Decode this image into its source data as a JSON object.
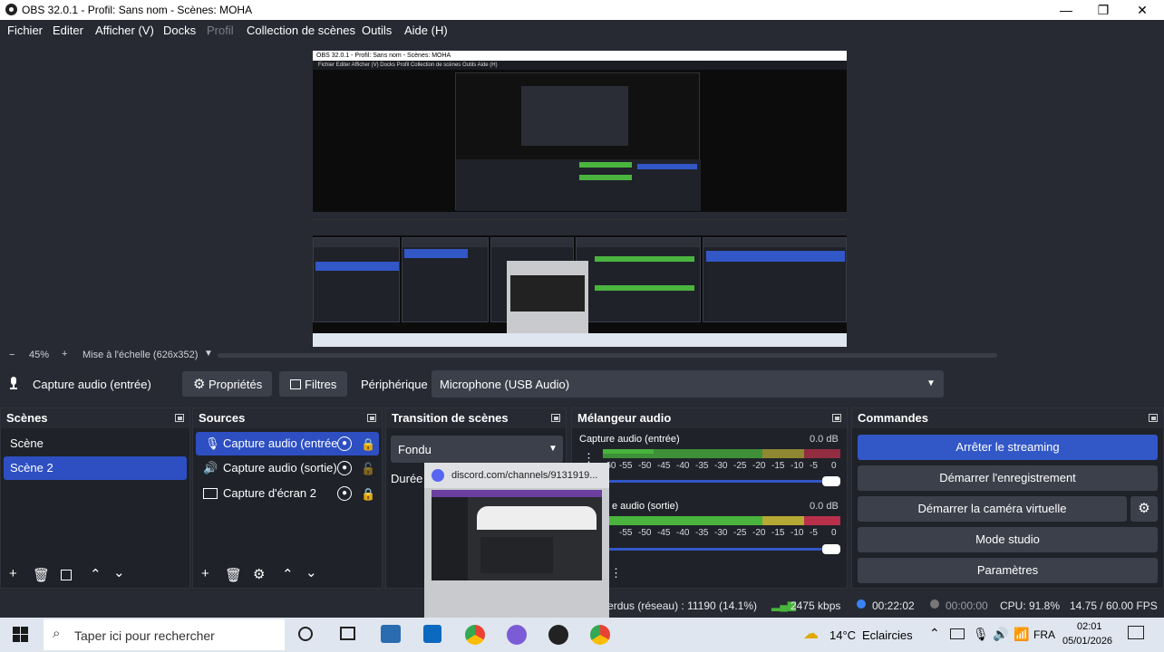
{
  "window": {
    "title": "OBS 32.0.1 - Profil: Sans nom - Scènes: MOHA",
    "minimize": "—",
    "maximize": "❐",
    "close": "✕"
  },
  "menu": [
    "Fichier",
    "Editer",
    "Afficher (V)",
    "Docks",
    "Profil",
    "Collection de scènes",
    "Outils",
    "Aide (H)"
  ],
  "zoom": {
    "minus": "−",
    "level": "45%",
    "plus": "+",
    "scale_label": "Mise à l'échelle (626x352)"
  },
  "source_bar": {
    "source_name": "Capture audio (entrée)",
    "properties_label": "Propriétés",
    "filters_label": "Filtres",
    "device_label": "Périphérique",
    "device_value": "Microphone (USB Audio)"
  },
  "scenes": {
    "title": "Scènes",
    "items": [
      "Scène",
      "Scène 2"
    ],
    "selected_index": 1
  },
  "sources": {
    "title": "Sources",
    "items": [
      "Capture audio (entrée",
      "Capture audio (sortie)",
      "Capture d'écran 2"
    ]
  },
  "transition": {
    "title": "Transition de scènes",
    "value": "Fondu",
    "duration_label": "Durée"
  },
  "mixer": {
    "title": "Mélangeur audio",
    "channels": [
      {
        "name": "Capture audio (entrée)",
        "db": "0.0 dB"
      },
      {
        "name": "e audio (sortie)",
        "db": "0.0 dB"
      }
    ],
    "ticks": [
      "-60",
      "-55",
      "-50",
      "-45",
      "-40",
      "-35",
      "-30",
      "-25",
      "-20",
      "-15",
      "-10",
      "-5",
      "0"
    ]
  },
  "commands": {
    "title": "Commandes",
    "buttons": [
      "Arrêter le streaming",
      "Démarrer l'enregistrement",
      "Démarrer la caméra virtuelle",
      "Mode studio",
      "Paramètres"
    ]
  },
  "status": {
    "dropped": "Paquets perdus (réseau) : 11190 (14.1%)",
    "bitrate": "2475 kbps",
    "stream_time": "00:22:02",
    "rec_time": "00:00:00",
    "cpu": "CPU: 91.8%",
    "fps": "14.75 / 60.00 FPS"
  },
  "discord_preview": {
    "url": "discord.com/channels/9131919..."
  },
  "taskbar": {
    "search_placeholder": "Taper ici pour rechercher",
    "weather_temp": "14°C",
    "weather_text": "Eclaircies",
    "language": "FRA",
    "time": "02:01",
    "date": "05/01/2026"
  },
  "nested_preview": {
    "title": "OBS 32.0.1 - Profil: Sans nom - Scènes: MOHA",
    "menu": "Fichier  Editer  Afficher (V)  Docks  Profil  Collection de scènes  Outils  Aide (H)"
  }
}
